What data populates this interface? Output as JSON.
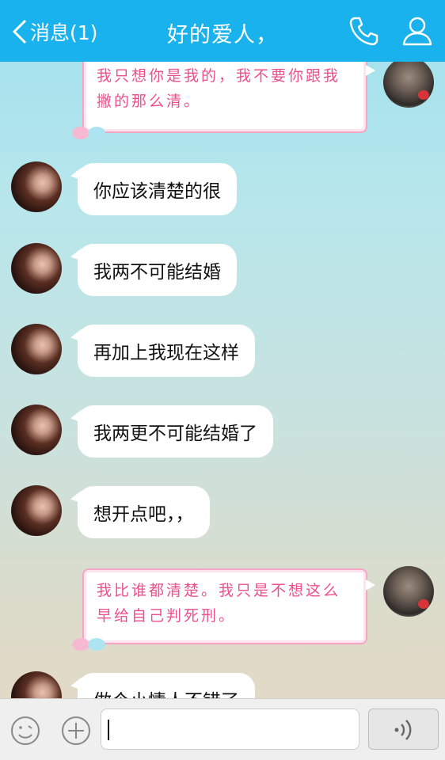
{
  "header": {
    "back_label": "消息(1)",
    "title": "好的爱人，",
    "call_icon": "phone-icon",
    "profile_icon": "user-icon"
  },
  "messages": [
    {
      "side": "right",
      "style": "pink",
      "text": "我只想你是我的，我不要你跟我撇的那么清。"
    },
    {
      "side": "left",
      "style": "white",
      "text": "你应该清楚的很"
    },
    {
      "side": "left",
      "style": "white",
      "text": "我两不可能结婚"
    },
    {
      "side": "left",
      "style": "white",
      "text": "再加上我现在这样"
    },
    {
      "side": "left",
      "style": "white",
      "text": "我两更不可能结婚了"
    },
    {
      "side": "left",
      "style": "white",
      "text": "想开点吧，，"
    },
    {
      "side": "right",
      "style": "pink",
      "text": "我比谁都清楚。我只是不想这么早给自己判死刑。"
    },
    {
      "side": "left",
      "style": "white",
      "text": "做个小情人不错了"
    }
  ],
  "input_bar": {
    "emoji_icon": "emoji-icon",
    "plus_icon": "plus-icon",
    "input_value": "",
    "voice_icon": "voice-icon"
  },
  "colors": {
    "header_bg": "#19b2ec",
    "pink_text": "#ee4f8c",
    "pink_border": "#f5a6c4"
  }
}
